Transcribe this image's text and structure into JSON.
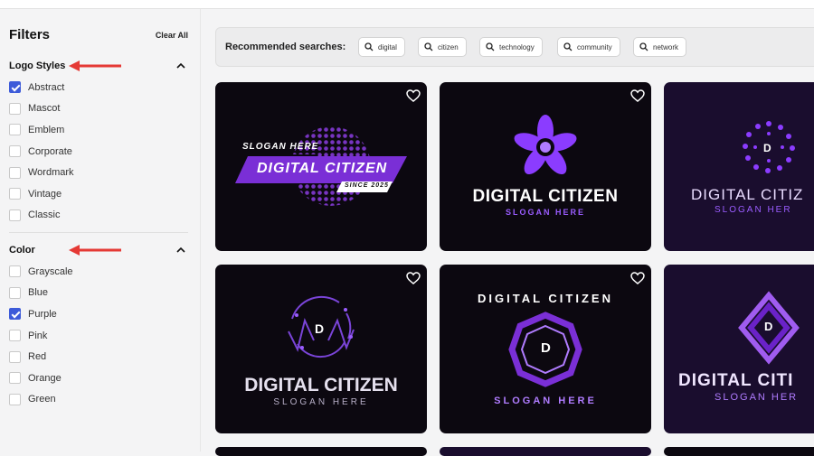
{
  "sidebar": {
    "title": "Filters",
    "clear_all": "Clear All",
    "logo_styles": {
      "title": "Logo Styles",
      "options": [
        {
          "label": "Abstract",
          "checked": true
        },
        {
          "label": "Mascot",
          "checked": false
        },
        {
          "label": "Emblem",
          "checked": false
        },
        {
          "label": "Corporate",
          "checked": false
        },
        {
          "label": "Wordmark",
          "checked": false
        },
        {
          "label": "Vintage",
          "checked": false
        },
        {
          "label": "Classic",
          "checked": false
        }
      ]
    },
    "color": {
      "title": "Color",
      "options": [
        {
          "label": "Grayscale",
          "checked": false
        },
        {
          "label": "Blue",
          "checked": false
        },
        {
          "label": "Purple",
          "checked": true
        },
        {
          "label": "Pink",
          "checked": false
        },
        {
          "label": "Red",
          "checked": false
        },
        {
          "label": "Orange",
          "checked": false
        },
        {
          "label": "Green",
          "checked": false
        }
      ]
    }
  },
  "recommended": {
    "label": "Recommended searches:",
    "chips": [
      "digital",
      "citizen",
      "technology",
      "community",
      "network"
    ]
  },
  "cards": [
    {
      "title": "DIGITAL CITIZEN",
      "slogan": "SLOGAN HERE",
      "badge": "SINCE 2025",
      "bg": "#0c0810"
    },
    {
      "title": "DIGITAL CITIZEN",
      "slogan": "SLOGAN HERE",
      "bg": "#0c0810"
    },
    {
      "title": "DIGITAL CITIZ",
      "slogan": "SLOGAN HER",
      "letter": "D",
      "bg": "#1a0d2e"
    },
    {
      "title": "DIGITAL CITIZEN",
      "slogan": "SLOGAN HERE",
      "letter": "D",
      "bg": "#0c0810"
    },
    {
      "title": "DIGITAL CITIZEN",
      "slogan": "SLOGAN HERE",
      "letter": "D",
      "bg": "#0c0810"
    },
    {
      "title": "DIGITAL CITI",
      "slogan": "SLOGAN HER",
      "letter": "D",
      "bg": "#1a0d2e"
    }
  ],
  "colors": {
    "accent": "#3d5bd9",
    "purple": "#8b3cff",
    "annotation_arrow": "#e53935"
  }
}
